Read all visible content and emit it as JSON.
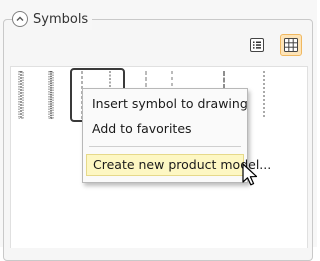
{
  "group": {
    "title": "Symbols"
  },
  "toolbar": {
    "list_view_icon": "list-icon",
    "grid_view_icon": "grid-icon",
    "grid_view_active": true
  },
  "symbols": {
    "count": 8,
    "selected_index": 2
  },
  "context_menu": {
    "items": [
      {
        "label": "Insert symbol to drawing"
      },
      {
        "label": "Add to favorites"
      },
      {
        "label": "Create new product model..."
      }
    ],
    "highlighted_index": 2
  },
  "colors": {
    "accent_active": "#fde4b8",
    "accent_border": "#f0b860",
    "menu_highlight": "#fdf7c3"
  }
}
